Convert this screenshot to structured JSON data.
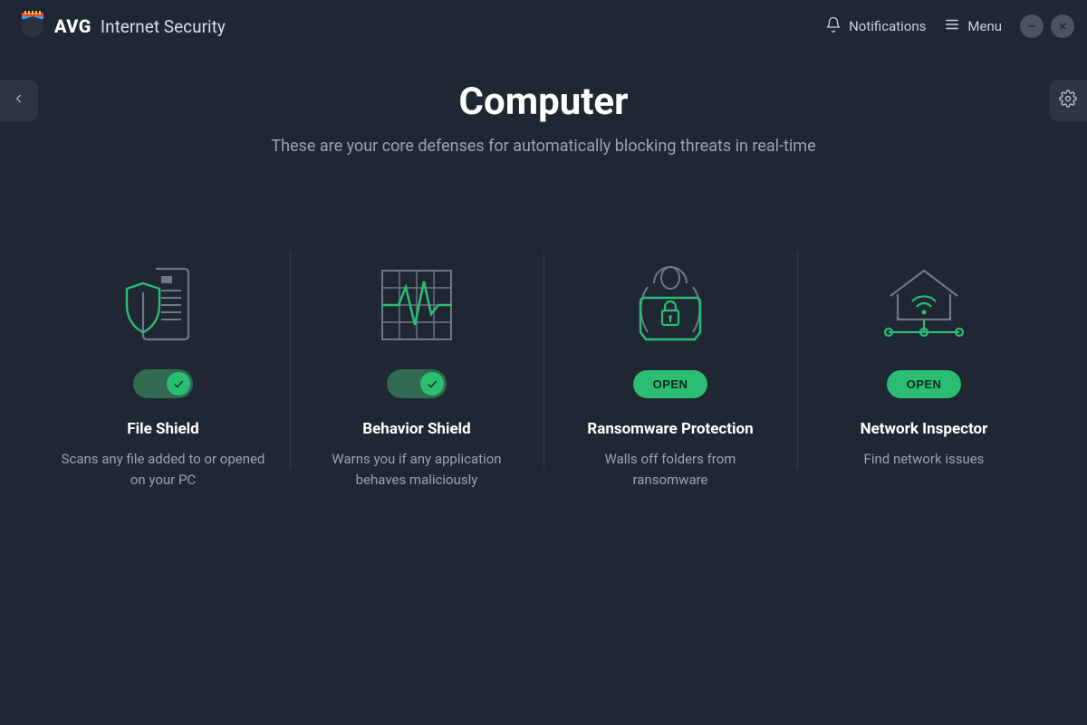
{
  "header": {
    "brand": "AVG",
    "product": "Internet Security",
    "notifications_label": "Notifications",
    "menu_label": "Menu"
  },
  "page": {
    "title": "Computer",
    "subtitle": "These are your core defenses for automatically blocking threats in real-time"
  },
  "cards": [
    {
      "id": "file-shield",
      "title": "File Shield",
      "description": "Scans any file added to or opened on your PC",
      "control": "toggle",
      "enabled": true
    },
    {
      "id": "behavior-shield",
      "title": "Behavior Shield",
      "description": "Warns you if any application behaves maliciously",
      "control": "toggle",
      "enabled": true
    },
    {
      "id": "ransomware-protection",
      "title": "Ransomware Protection",
      "description": "Walls off folders from ransomware",
      "control": "button",
      "button_label": "OPEN"
    },
    {
      "id": "network-inspector",
      "title": "Network Inspector",
      "description": "Find network issues",
      "control": "button",
      "button_label": "OPEN"
    }
  ],
  "colors": {
    "accent": "#2bbd72",
    "background": "#1f2733"
  }
}
